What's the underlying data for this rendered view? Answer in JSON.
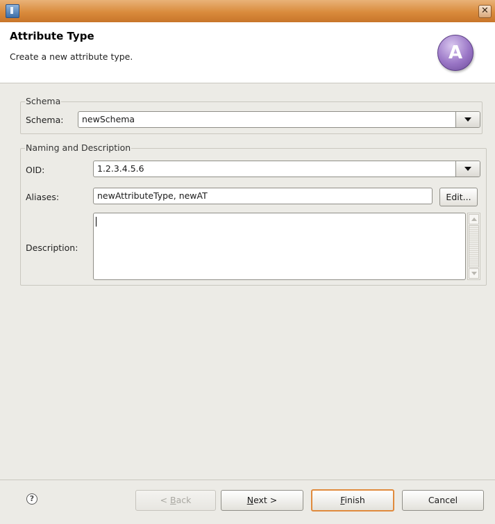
{
  "window": {
    "close_glyph": "✕"
  },
  "header": {
    "title": "Attribute Type",
    "description": "Create a new attribute type.",
    "banner_letter": "A",
    "banner_color": "#9a76c6"
  },
  "schema_group": {
    "legend": "Schema",
    "schema_label": "Schema:",
    "schema_value": "newSchema"
  },
  "naming_group": {
    "legend": "Naming and Description",
    "oid_label": "OID:",
    "oid_value": "1.2.3.4.5.6",
    "aliases_label": "Aliases:",
    "aliases_value": "newAttributeType, newAT",
    "edit_label": "Edit...",
    "description_label": "Description:",
    "description_value": ""
  },
  "footer": {
    "help_glyph": "?",
    "back": {
      "prefix": "< ",
      "mnemonic": "B",
      "rest": "ack"
    },
    "next": {
      "mnemonic": "N",
      "rest": "ext >"
    },
    "finish": {
      "mnemonic": "F",
      "rest": "inish"
    },
    "cancel_label": "Cancel"
  },
  "colors": {
    "titlebar": "#d98b3c",
    "default_button_border": "#e08a3c"
  }
}
